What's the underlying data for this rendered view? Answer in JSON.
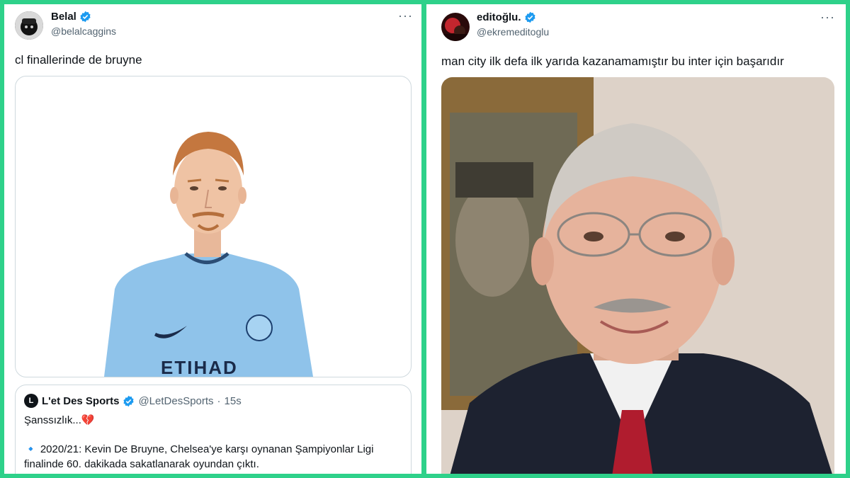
{
  "left_tweet": {
    "author_name": "Belal",
    "author_handle": "@belalcaggins",
    "more_label": "···",
    "text": "cl finallerinde de bruyne",
    "quote": {
      "logo_letter": "L",
      "author_name": "L'et Des Sports",
      "author_handle": "@LetDesSports",
      "separator": "·",
      "time": "15s",
      "line1": "Şanssızlık...💔",
      "line2": "🔹 2020/21: Kevin De Bruyne, Chelsea'ye karşı oynanan Şampiyonlar Ligi",
      "line3": "finalinde 60. dakikada sakatlanarak oyundan çıktı."
    },
    "jersey_sponsor": "ETIHAD"
  },
  "right_tweet": {
    "author_name": "editoğlu.",
    "author_handle": "@ekremeditoglu",
    "more_label": "···",
    "text": "man city ilk defa ilk yarıda kazanamamıştır bu inter için başarıdır"
  },
  "colors": {
    "frame": "#2ed18a",
    "verified": "#1d9bf0",
    "secondary_text": "#536471",
    "jersey": "#8fc3ea"
  }
}
